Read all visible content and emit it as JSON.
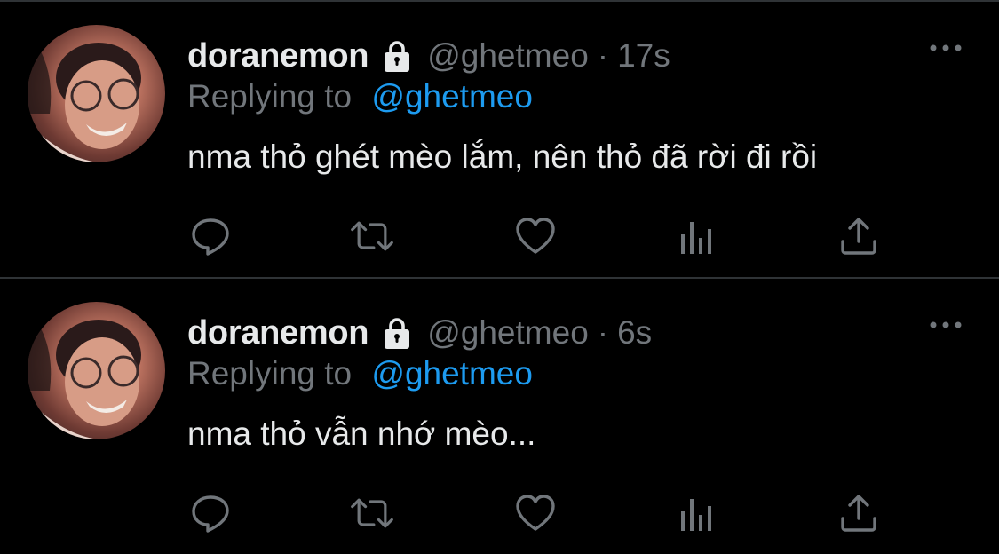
{
  "tweets": [
    {
      "display_name": "doranemon",
      "handle": "@ghetmeo",
      "separator": "·",
      "time": "17s",
      "reply_prefix": "Replying to",
      "reply_to": "@ghetmeo",
      "text": "nma thỏ ghét mèo lắm, nên thỏ đã rời đi rồi"
    },
    {
      "display_name": "doranemon",
      "handle": "@ghetmeo",
      "separator": "·",
      "time": "6s",
      "reply_prefix": "Replying to",
      "reply_to": "@ghetmeo",
      "text": "nma thỏ vẫn nhớ mèo..."
    }
  ],
  "icons": {
    "protected": "lock-icon",
    "more": "more-horizontal-icon",
    "reply": "reply-icon",
    "retweet": "retweet-icon",
    "like": "heart-icon",
    "analytics": "analytics-icon",
    "share": "share-icon"
  },
  "colors": {
    "background": "#000000",
    "text": "#e7e9ea",
    "secondary": "#71767b",
    "accent": "#1d9bf0",
    "divider": "#2f3336"
  }
}
